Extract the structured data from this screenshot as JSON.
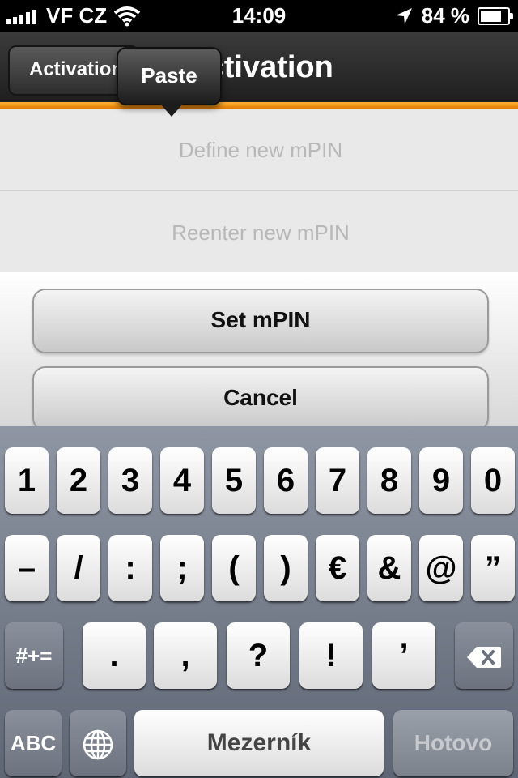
{
  "status": {
    "carrier": "VF CZ",
    "time": "14:09",
    "battery": "84 %",
    "battery_level": 0.84
  },
  "nav": {
    "back_label": "Activation",
    "title": "Activation"
  },
  "popover": {
    "paste_label": "Paste"
  },
  "form": {
    "new_pin_placeholder": "Define new mPIN",
    "reenter_pin_placeholder": "Reenter new mPIN",
    "set_label": "Set mPIN",
    "cancel_label": "Cancel"
  },
  "keyboard": {
    "row1": [
      "1",
      "2",
      "3",
      "4",
      "5",
      "6",
      "7",
      "8",
      "9",
      "0"
    ],
    "row2": [
      "–",
      "/",
      ":",
      ";",
      "(",
      ")",
      "€",
      "&",
      "@",
      "”"
    ],
    "row3": [
      ".",
      ",",
      "?",
      "!",
      "’"
    ],
    "symbols_label": "#+=",
    "abc_label": "ABC",
    "space_label": "Mezerník",
    "done_label": "Hotovo"
  }
}
